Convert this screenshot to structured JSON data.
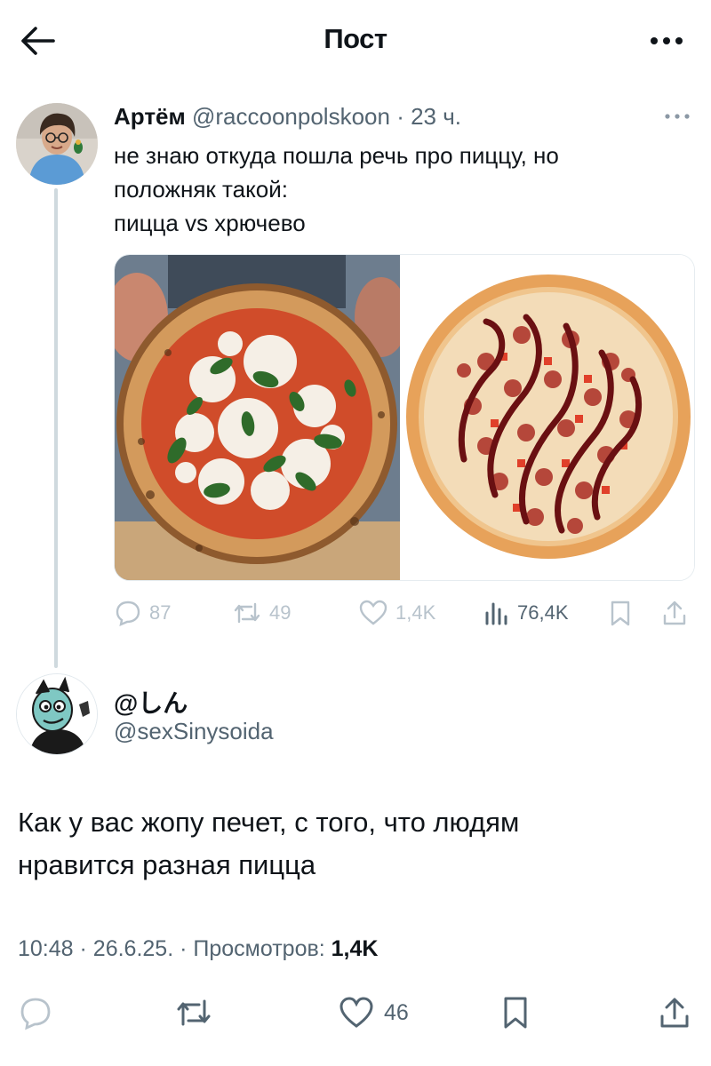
{
  "header": {
    "title": "Пост",
    "back_icon": "arrow-left-icon",
    "more_icon": "more-horizontal-icon"
  },
  "parent_post": {
    "author_name": "Артём",
    "author_handle": "@raccoonpolskoon",
    "separator": "·",
    "time": "23 ч.",
    "text_lines": [
      "не знаю откуда пошла речь про пиццу, но",
      "положняк такой:",
      "пицца vs хрючево"
    ],
    "images": [
      "margherita-pizza-photo",
      "sausage-bbq-pizza-photo"
    ],
    "stats": {
      "replies": "87",
      "reposts": "49",
      "likes": "1,4K",
      "views": "76,4K"
    }
  },
  "reply_post": {
    "author_name": "@しん",
    "author_handle": "@sexSinysoida",
    "text_lines": [
      "Как у вас жопу печет, с того, что людям",
      "нравится разная пицца"
    ],
    "time": "10:48",
    "dot1": "·",
    "date": "26.6.25.",
    "dot2": "·",
    "views_label": "Просмотров:",
    "views_value": "1,4K",
    "likes": "46"
  },
  "colors": {
    "text": "#0f1419",
    "muted": "#536471",
    "faded": "#b8c3cc",
    "line": "#cfd9de"
  }
}
